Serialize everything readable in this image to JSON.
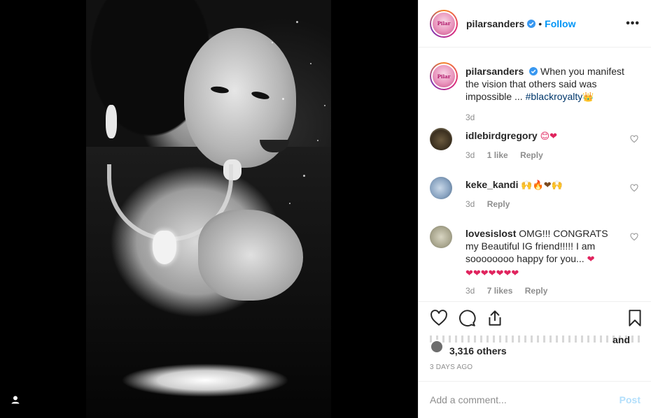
{
  "post": {
    "author": "pilarsanders",
    "follow_label": "Follow",
    "separator": "•",
    "more_label": "•••",
    "avatar_text": "Pilar"
  },
  "caption": {
    "username": "pilarsanders",
    "text": "When you manifest the vision that others said was impossible ... ",
    "hashtag": "#blackroyalty",
    "emoji": "👑",
    "time": "3d"
  },
  "comments": [
    {
      "username": "idlebirdgregory",
      "text": "",
      "emoji": "😊❤",
      "time": "3d",
      "likes": "1 like",
      "reply": "Reply"
    },
    {
      "username": "keke_kandi",
      "text": "",
      "emoji": "🙌🔥❤🙌",
      "time": "3d",
      "likes": "",
      "reply": "Reply"
    },
    {
      "username": "lovesislost",
      "text": "OMG!!! CONGRATS my Beautiful IG friend!!!!! I am soooooooo happy for you... ",
      "emoji": "❤",
      "emoji_line2": "❤❤❤❤❤❤❤",
      "time": "3d",
      "likes": "7 likes",
      "reply": "Reply"
    }
  ],
  "likes": {
    "and_text": "and",
    "others_text": "3,316 others"
  },
  "timestamp": "3 DAYS AGO",
  "add_comment": {
    "placeholder": "Add a comment...",
    "post_label": "Post"
  },
  "colors": {
    "accent": "#0095f6",
    "post_disabled": "#b2dffc",
    "meta": "#8e8e8e",
    "hashtag": "#00376b"
  }
}
